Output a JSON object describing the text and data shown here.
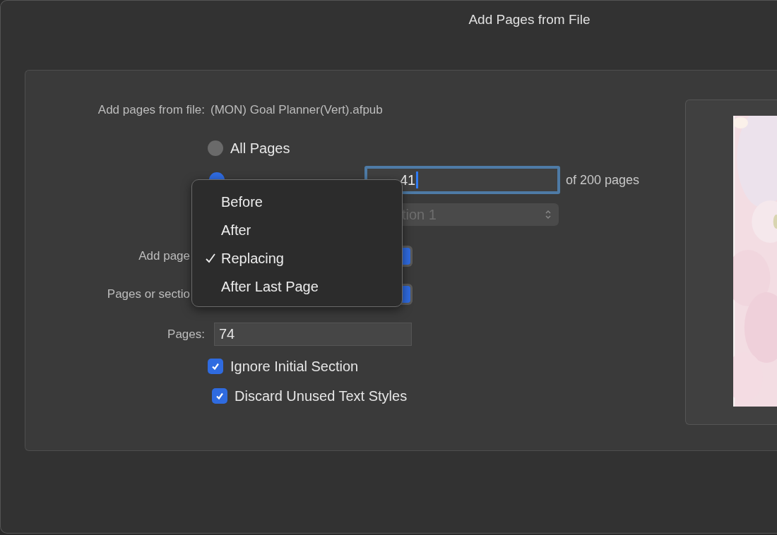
{
  "window": {
    "title": "Add Pages from File"
  },
  "source": {
    "label": "Add pages from file:",
    "value": "(MON) Goal Planner(Vert).afpub"
  },
  "page_options": [
    {
      "label": "All Pages",
      "selected": false
    },
    {
      "selected": true
    }
  ],
  "page_numbers": {
    "value": "41",
    "focused": true,
    "suffix": "of 200 pages"
  },
  "section_popup": {
    "value": "tion 1",
    "disabled": true
  },
  "add_pages": {
    "label": "Add page"
  },
  "pages_or_sections": {
    "label": "Pages or sectio"
  },
  "pages": {
    "label": "Pages:",
    "value": "74"
  },
  "checkboxes": [
    {
      "label": "Ignore Initial Section",
      "checked": true
    },
    {
      "label": "Discard Unused Text Styles",
      "checked": true
    }
  ],
  "menu": {
    "items": [
      {
        "label": "Before",
        "checked": false
      },
      {
        "label": "After",
        "checked": false
      },
      {
        "label": "Replacing",
        "checked": true
      },
      {
        "label": "After Last Page",
        "checked": false
      }
    ]
  }
}
